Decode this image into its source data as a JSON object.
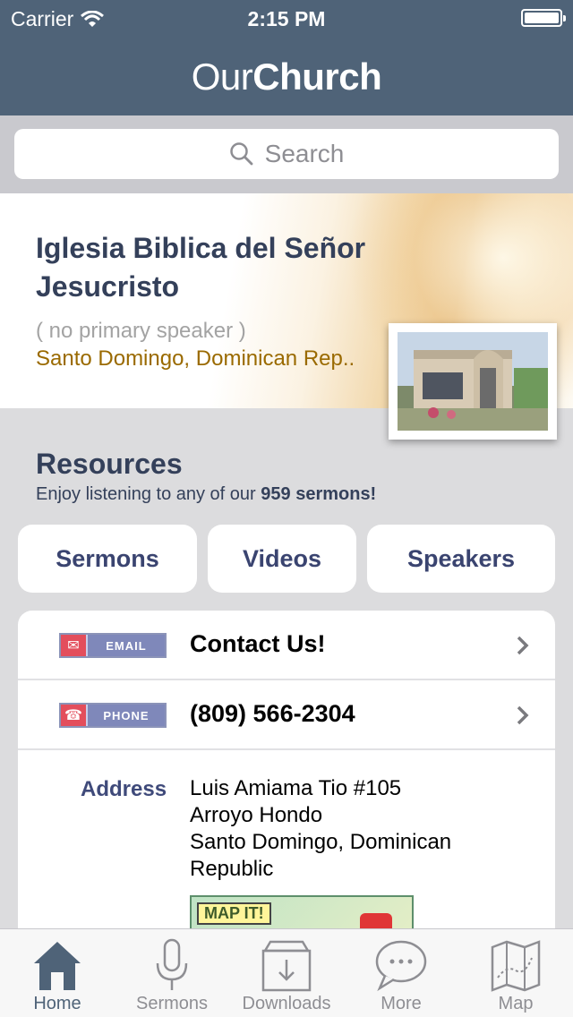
{
  "status_bar": {
    "carrier": "Carrier",
    "time": "2:15 PM"
  },
  "brand": {
    "part1": "Our",
    "part2": "Church"
  },
  "search": {
    "placeholder": "Search"
  },
  "church": {
    "name": "Iglesia Biblica del Señor Jesucristo",
    "speaker": "( no primary speaker )",
    "location": "Santo Domingo, Dominican Rep.."
  },
  "resources": {
    "title": "Resources",
    "subtitle_prefix": "Enjoy listening to any of our ",
    "subtitle_bold": "959 sermons!",
    "buttons": {
      "sermons": "Sermons",
      "videos": "Videos",
      "speakers": "Speakers"
    }
  },
  "contact": {
    "email_badge": "EMAIL",
    "email_label": "Contact Us!",
    "phone_badge": "PHONE",
    "phone_label": "(809) 566-2304",
    "address_label": "Address",
    "address_line1": "Luis Amiama Tio #105",
    "address_line2": "Arroyo Hondo",
    "address_line3": "Santo Domingo, Dominican",
    "address_line4": "Republic",
    "map_badge": "MAP IT!"
  },
  "tabs": {
    "home": "Home",
    "sermons": "Sermons",
    "downloads": "Downloads",
    "more": "More",
    "map": "Map"
  },
  "colors": {
    "header": "#4f6378",
    "title_text": "#34405a",
    "location_text": "#9a6a00",
    "button_text": "#3a4470"
  }
}
